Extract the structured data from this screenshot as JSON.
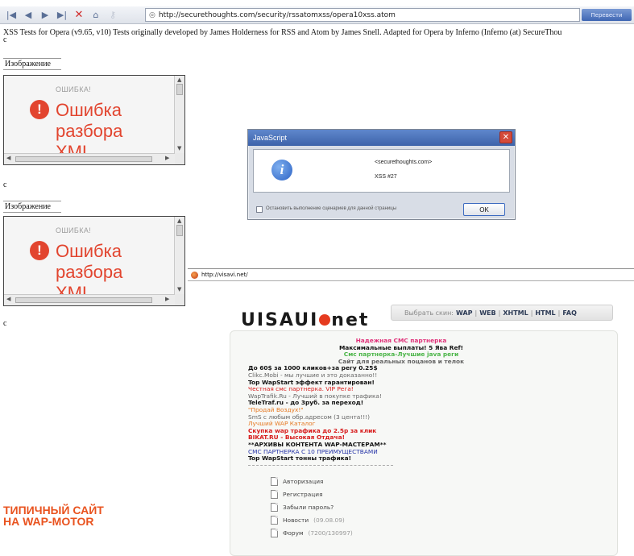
{
  "toolbar": {
    "url": "http://securethoughts.com/security/rssatomxss/opera10xss.atom",
    "right_button": "Перевести"
  },
  "page": {
    "header": "XSS Tests for Opera (v9.65, v10) Tests originally developed by James Holderness for RSS and Atom by James Snell. Adapted for Opera by Inferno (Inferno (at) SecureThou",
    "small_c": "c",
    "image_label": "Изображение",
    "error_small": "ОШИБКА!",
    "error_line1": "Ошибка",
    "error_line2": "разбора",
    "error_line3": "XML"
  },
  "dialog": {
    "title": "JavaScript",
    "line1": "<securethoughts.com>",
    "line2": "XSS #27",
    "checkbox_label": "Остановить выполнение сценариев для данной страницы",
    "ok": "OK"
  },
  "browser2": {
    "url": "http://visavi.net/",
    "logo_left": "UISAUI",
    "logo_right": "net",
    "skin_prefix": "Выбрать скин:",
    "skins": [
      "WAP",
      "WEB",
      "XHTML",
      "HTML",
      "FAQ"
    ],
    "ads": [
      "Надежная СМС партнерка",
      "Максимальные выплаты! 5 Ява Ref!",
      "Смс партнерка-Лучшие java реги",
      "Сайт для реальных поцанов и телок",
      "До 60$ за 1000 кликов+за регу 0.25$",
      "Clikc.Mobi - мы лучшие и это доказанно!!",
      "Top WapStart эффект гарантирован!",
      "Честная смс партнерка. VIP Рега!",
      "WapTrafik.Ru - Лучший в покупке трафика!",
      "TeleTraf.ru - до 3руб. за переход!",
      "\"Продай Воздух!\"",
      "SmS с любым обр.адресом (3 цента!!!)",
      "Лучший WAP Каталог",
      "Скупка wap трафика до 2.5р за клик",
      "BIKAT.RU - Высокая Отдача!",
      "**АРХИВЫ КОНТЕНТА WAP-МАСТЕРАМ**",
      "СМС ПАРТНЕРКА С 10 ПРЕИМУЩЕСТВАМИ",
      "Top WapStart тонны трафика!"
    ],
    "menu": [
      {
        "label": "Авторизация",
        "meta": ""
      },
      {
        "label": "Регистрация",
        "meta": ""
      },
      {
        "label": "Забыли пароль?",
        "meta": ""
      },
      {
        "label": "Новости",
        "meta": "(09.08.09)"
      },
      {
        "label": "Форум",
        "meta": "(7200/130997)"
      }
    ]
  },
  "caption": {
    "line1": "ТИПИЧНЫЙ САЙТ",
    "line2": "НА WAP-MOTOR"
  }
}
